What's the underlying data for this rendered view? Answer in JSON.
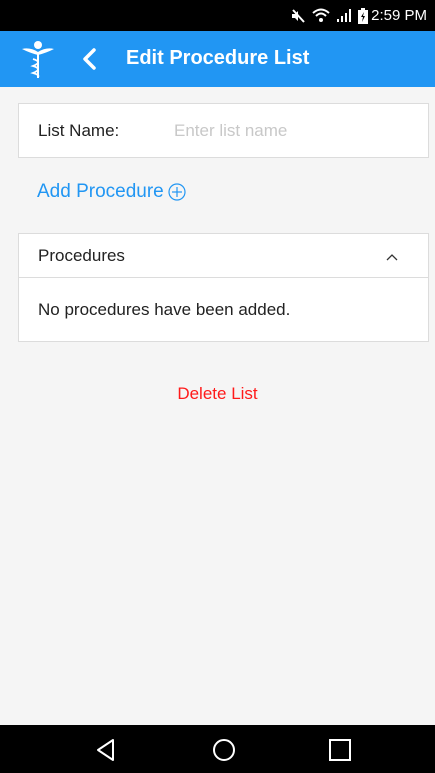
{
  "status_bar": {
    "time": "2:59 PM",
    "icons": [
      "mute-icon",
      "wifi-icon",
      "signal-icon",
      "battery-icon"
    ]
  },
  "app_bar": {
    "title": "Edit Procedure List",
    "logo": "caduceus-logo-icon",
    "background": "#2196f3"
  },
  "list_name": {
    "label": "List Name:",
    "value": "",
    "placeholder": "Enter list name"
  },
  "add_procedure": {
    "label": "Add Procedure",
    "icon": "plus-circle-icon",
    "color": "#2196f3"
  },
  "procedures": {
    "title": "Procedures",
    "expanded": true,
    "empty_message": "No procedures have been added."
  },
  "delete": {
    "label": "Delete List",
    "color": "#ff1a1a"
  },
  "nav_bar": {
    "buttons": [
      "back-triangle-icon",
      "home-circle-icon",
      "recents-square-icon"
    ]
  }
}
